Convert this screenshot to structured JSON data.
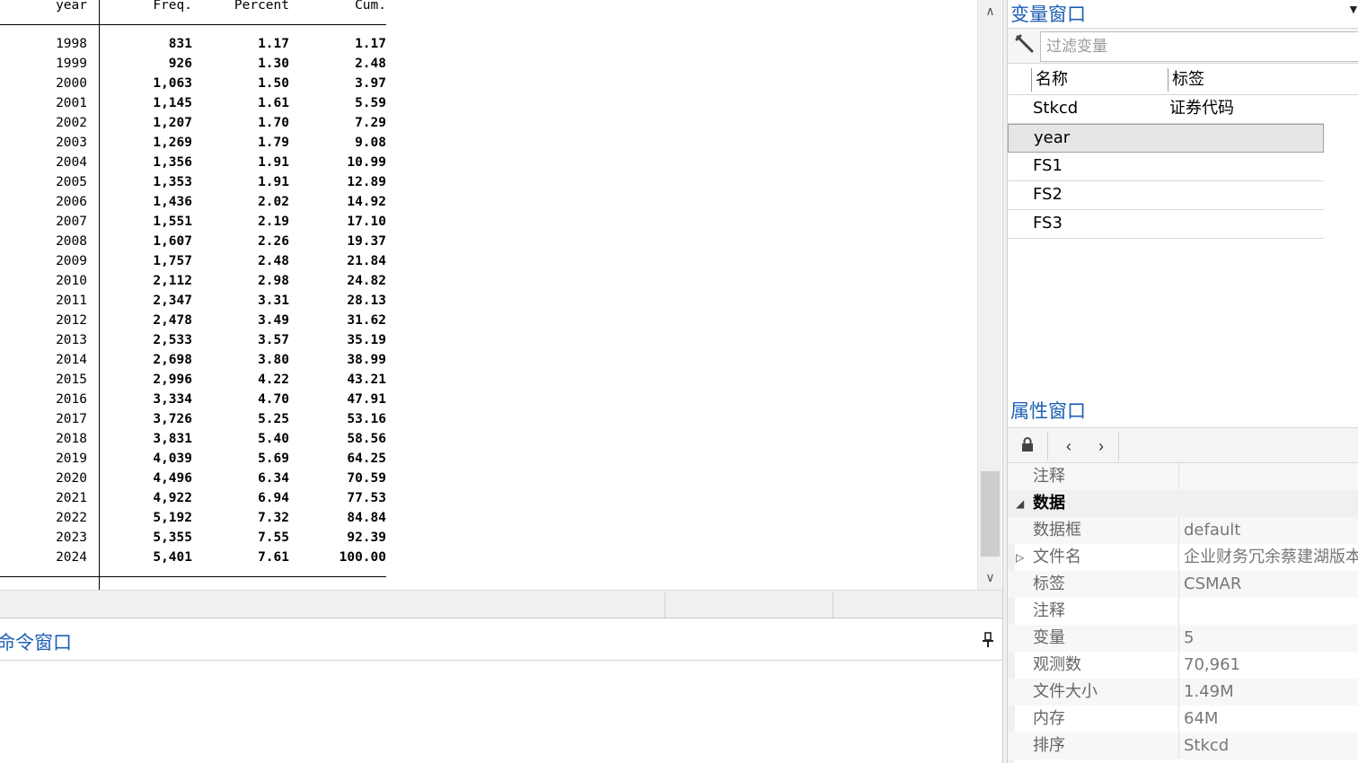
{
  "results": {
    "headers": {
      "year": "year",
      "freq": "Freq.",
      "percent": "Percent",
      "cum": "Cum."
    },
    "rows": [
      {
        "year": "1998",
        "freq": "831",
        "percent": "1.17",
        "cum": "1.17"
      },
      {
        "year": "1999",
        "freq": "926",
        "percent": "1.30",
        "cum": "2.48"
      },
      {
        "year": "2000",
        "freq": "1,063",
        "percent": "1.50",
        "cum": "3.97"
      },
      {
        "year": "2001",
        "freq": "1,145",
        "percent": "1.61",
        "cum": "5.59"
      },
      {
        "year": "2002",
        "freq": "1,207",
        "percent": "1.70",
        "cum": "7.29"
      },
      {
        "year": "2003",
        "freq": "1,269",
        "percent": "1.79",
        "cum": "9.08"
      },
      {
        "year": "2004",
        "freq": "1,356",
        "percent": "1.91",
        "cum": "10.99"
      },
      {
        "year": "2005",
        "freq": "1,353",
        "percent": "1.91",
        "cum": "12.89"
      },
      {
        "year": "2006",
        "freq": "1,436",
        "percent": "2.02",
        "cum": "14.92"
      },
      {
        "year": "2007",
        "freq": "1,551",
        "percent": "2.19",
        "cum": "17.10"
      },
      {
        "year": "2008",
        "freq": "1,607",
        "percent": "2.26",
        "cum": "19.37"
      },
      {
        "year": "2009",
        "freq": "1,757",
        "percent": "2.48",
        "cum": "21.84"
      },
      {
        "year": "2010",
        "freq": "2,112",
        "percent": "2.98",
        "cum": "24.82"
      },
      {
        "year": "2011",
        "freq": "2,347",
        "percent": "3.31",
        "cum": "28.13"
      },
      {
        "year": "2012",
        "freq": "2,478",
        "percent": "3.49",
        "cum": "31.62"
      },
      {
        "year": "2013",
        "freq": "2,533",
        "percent": "3.57",
        "cum": "35.19"
      },
      {
        "year": "2014",
        "freq": "2,698",
        "percent": "3.80",
        "cum": "38.99"
      },
      {
        "year": "2015",
        "freq": "2,996",
        "percent": "4.22",
        "cum": "43.21"
      },
      {
        "year": "2016",
        "freq": "3,334",
        "percent": "4.70",
        "cum": "47.91"
      },
      {
        "year": "2017",
        "freq": "3,726",
        "percent": "5.25",
        "cum": "53.16"
      },
      {
        "year": "2018",
        "freq": "3,831",
        "percent": "5.40",
        "cum": "58.56"
      },
      {
        "year": "2019",
        "freq": "4,039",
        "percent": "5.69",
        "cum": "64.25"
      },
      {
        "year": "2020",
        "freq": "4,496",
        "percent": "6.34",
        "cum": "70.59"
      },
      {
        "year": "2021",
        "freq": "4,922",
        "percent": "6.94",
        "cum": "77.53"
      },
      {
        "year": "2022",
        "freq": "5,192",
        "percent": "7.32",
        "cum": "84.84"
      },
      {
        "year": "2023",
        "freq": "5,355",
        "percent": "7.55",
        "cum": "92.39"
      },
      {
        "year": "2024",
        "freq": "5,401",
        "percent": "7.61",
        "cum": "100.00"
      }
    ]
  },
  "command_window": {
    "title": "命令窗口",
    "pin_icon": "pin-icon"
  },
  "variables_window": {
    "title": "变量窗口",
    "filter_placeholder": "过滤变量",
    "col_name": "名称",
    "col_label": "标签",
    "variables": [
      {
        "name": "Stkcd",
        "label": "证券代码",
        "selected": false
      },
      {
        "name": "year",
        "label": "",
        "selected": true
      },
      {
        "name": "FS1",
        "label": "",
        "selected": false
      },
      {
        "name": "FS2",
        "label": "",
        "selected": false
      },
      {
        "name": "FS3",
        "label": "",
        "selected": false
      }
    ]
  },
  "properties_window": {
    "title": "属性窗口",
    "rows": [
      {
        "key": "注释",
        "value": "",
        "type": "item"
      },
      {
        "key": "数据",
        "value": "",
        "type": "section"
      },
      {
        "key": "数据框",
        "value": "default",
        "type": "item"
      },
      {
        "key": "文件名",
        "value": "企业财务冗余蔡建湖版本",
        "type": "expandable"
      },
      {
        "key": "标签",
        "value": "CSMAR",
        "type": "item"
      },
      {
        "key": "注释",
        "value": "",
        "type": "item"
      },
      {
        "key": "变量",
        "value": "5",
        "type": "item"
      },
      {
        "key": "观测数",
        "value": "70,961",
        "type": "item"
      },
      {
        "key": "文件大小",
        "value": "1.49M",
        "type": "item"
      },
      {
        "key": "内存",
        "value": "64M",
        "type": "item"
      },
      {
        "key": "排序",
        "value": "Stkcd",
        "type": "item"
      }
    ]
  },
  "colors": {
    "accent": "#1d5fb6",
    "panel_bg": "#f0f0f0"
  }
}
